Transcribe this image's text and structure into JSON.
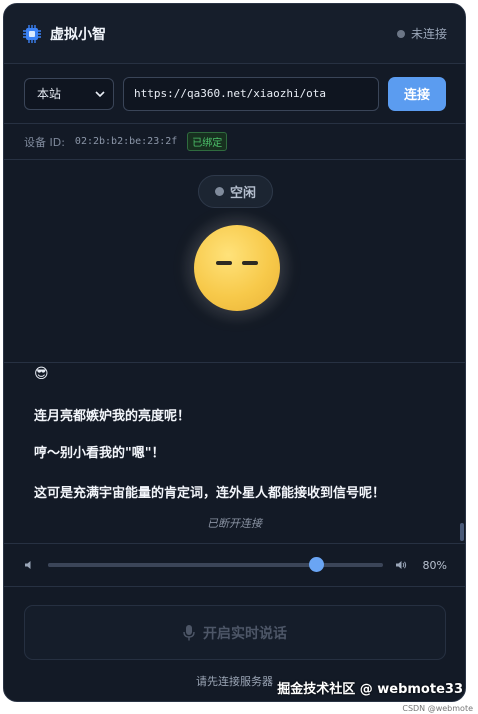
{
  "header": {
    "title": "虚拟小智",
    "status": "未连接",
    "icon": "cpu-chip-icon"
  },
  "connection": {
    "server_select": "本站",
    "url": "https://qa360.net/xiaozhi/ota",
    "connect_label": "连接"
  },
  "device": {
    "label": "设备 ID:",
    "id": "02:2b:b2:be:23:2f",
    "badge": "已绑定"
  },
  "face": {
    "state": "空闲",
    "expression": "neutral-face"
  },
  "chat": {
    "emoji": "😎",
    "messages": [
      "连月亮都嫉妒我的亮度呢！",
      "哼～别小看我的\"嗯\"！",
      "这可是充满宇宙能量的肯定词，连外星人都能接收到信号呢！"
    ],
    "system_note": "已断开连接"
  },
  "volume": {
    "value": 0.8,
    "display": "80%"
  },
  "talk": {
    "label": "开启实时说话",
    "hint": "请先连接服务器",
    "icon": "microphone-icon"
  },
  "watermark": {
    "main": "掘金技术社区 @ webmote33",
    "sub": "CSDN @webmote"
  },
  "colors": {
    "accent": "#5b9cf0",
    "background": "#131a26",
    "badge_green": "#4cc06a"
  }
}
